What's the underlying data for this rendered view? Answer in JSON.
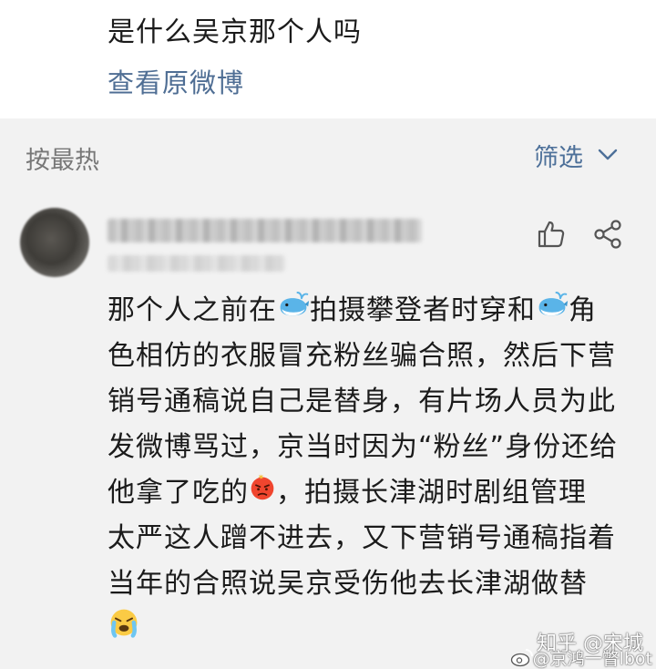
{
  "post": {
    "text": "是什么吴京那个人吗",
    "view_original": "查看原微博"
  },
  "comments_header": {
    "sort_label": "按最热",
    "filter_label": "筛选"
  },
  "comment": {
    "lines": [
      [
        "那个人之前在",
        "whale",
        "拍摄攀登者时穿和",
        "whale",
        "角"
      ],
      [
        "色相仿的衣服冒充粉丝骗合照，然后下营"
      ],
      [
        "销号通稿说自己是替身，有片场人员为此"
      ],
      [
        "发微博骂过，京当时因为“粉丝”身份还给"
      ],
      [
        "他拿了吃的",
        "angry",
        "，拍摄长津湖时剧组管理"
      ],
      [
        "太严这人蹭不进去，又下营销号通稿指着"
      ],
      [
        "当年的合照说吴京受伤他去长津湖做替"
      ],
      [
        "crying"
      ]
    ]
  },
  "watermark": {
    "zhihu": "知乎 @宋城",
    "weibo": "@京鸿一瞥lbot"
  },
  "colors": {
    "link": "#4f6e94",
    "background": "#f2f2f2"
  }
}
